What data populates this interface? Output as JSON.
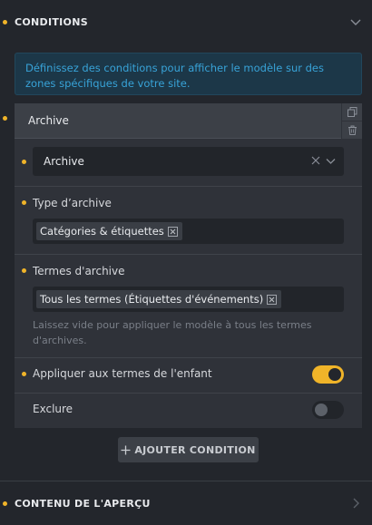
{
  "conditions": {
    "title": "CONDITIONS",
    "info": "Définissez des conditions pour afficher le modèle sur des zones spécifiques de votre site.",
    "card": {
      "title": "Archive",
      "select_value": "Archive",
      "archive_type": {
        "label": "Type d’archive",
        "tags": [
          "Catégories & étiquettes"
        ]
      },
      "archive_terms": {
        "label": "Termes d'archive",
        "tags": [
          "Tous les termes (Étiquettes d'événements)"
        ],
        "help": "Laissez vide pour appliquer le modèle à tous les termes d'archives."
      },
      "child_terms": {
        "label": "Appliquer aux termes de l'enfant",
        "on": true
      },
      "exclude": {
        "label": "Exclure",
        "on": false
      }
    },
    "add_button": "AJOUTER CONDITION"
  },
  "preview": {
    "title": "CONTENU DE L'APERÇU"
  },
  "colors": {
    "accent": "#f0b429",
    "info_text": "#38a3d8",
    "info_bg": "#1c3748",
    "panel_bg": "#23262c",
    "card_bg": "#2f3239"
  },
  "icons": {
    "conditions_header": "chevron-down-icon",
    "card_copy": "copy-icon",
    "card_delete": "trash-icon",
    "select_clear": "close-icon",
    "select_open": "chevron-down-icon",
    "tag_remove": "square-x-icon",
    "add": "plus-icon",
    "preview_header": "chevron-right-icon"
  }
}
